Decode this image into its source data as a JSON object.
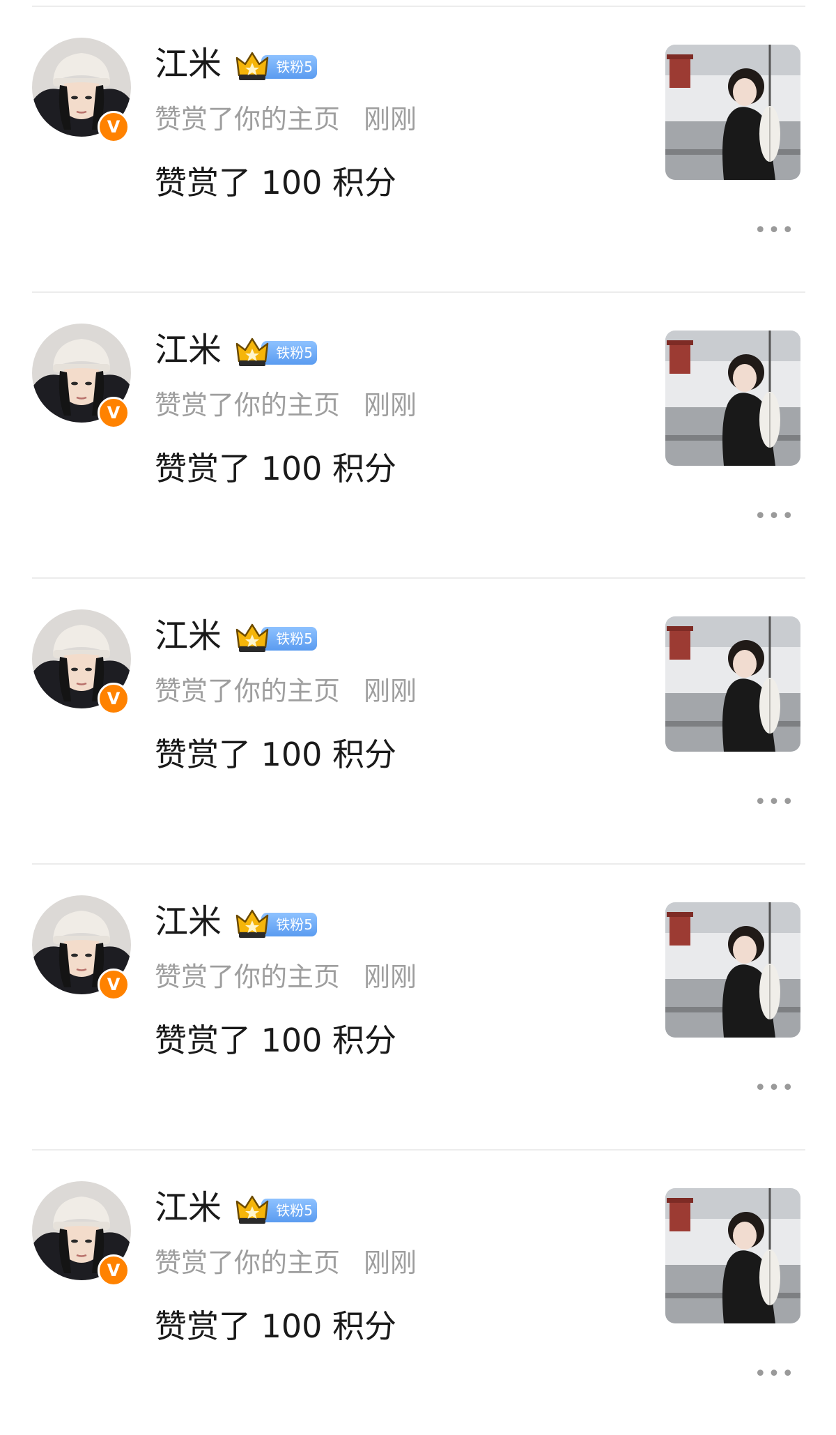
{
  "notifications": [
    {
      "username": "江米",
      "verified_badge_glyph": "V",
      "fan_badge": {
        "icon": "crown-icon",
        "label": "铁粉5"
      },
      "action": "赞赏了你的主页",
      "time": "刚刚",
      "content": "赞赏了 100 积分",
      "more_glyph": "•••"
    },
    {
      "username": "江米",
      "verified_badge_glyph": "V",
      "fan_badge": {
        "icon": "crown-icon",
        "label": "铁粉5"
      },
      "action": "赞赏了你的主页",
      "time": "刚刚",
      "content": "赞赏了 100 积分",
      "more_glyph": "•••"
    },
    {
      "username": "江米",
      "verified_badge_glyph": "V",
      "fan_badge": {
        "icon": "crown-icon",
        "label": "铁粉5"
      },
      "action": "赞赏了你的主页",
      "time": "刚刚",
      "content": "赞赏了 100 积分",
      "more_glyph": "•••"
    },
    {
      "username": "江米",
      "verified_badge_glyph": "V",
      "fan_badge": {
        "icon": "crown-icon",
        "label": "铁粉5"
      },
      "action": "赞赏了你的主页",
      "time": "刚刚",
      "content": "赞赏了 100 积分",
      "more_glyph": "•••"
    },
    {
      "username": "江米",
      "verified_badge_glyph": "V",
      "fan_badge": {
        "icon": "crown-icon",
        "label": "铁粉5"
      },
      "action": "赞赏了你的主页",
      "time": "刚刚",
      "content": "赞赏了 100 积分",
      "more_glyph": "•••"
    }
  ],
  "colors": {
    "verified_badge": "#ff8200",
    "fan_badge": "#5a9bf0",
    "crown": "#f5b50a",
    "primary_text": "#1a1a1a",
    "secondary_text": "#9e9e9e",
    "divider": "#ececec"
  }
}
